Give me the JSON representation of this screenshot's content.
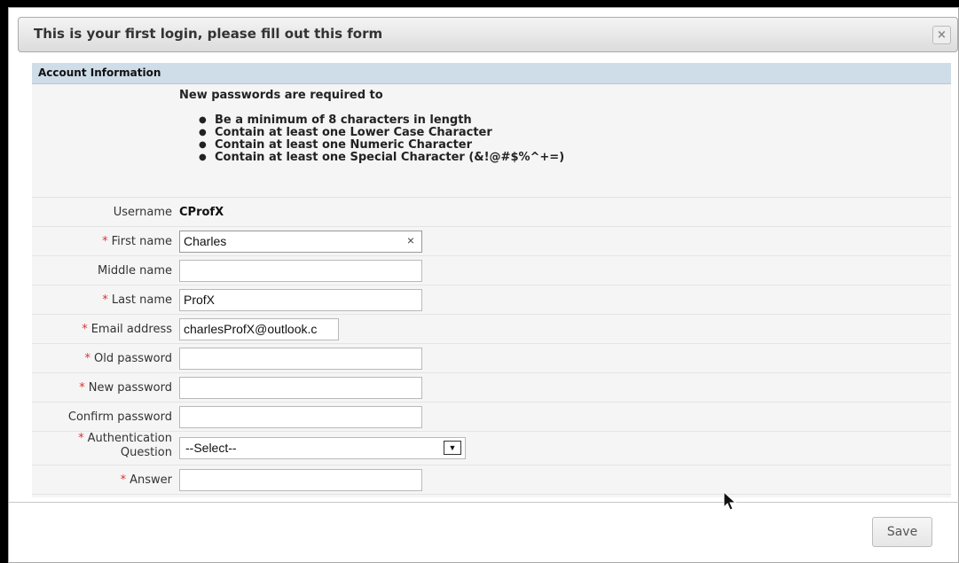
{
  "dialog": {
    "title": "This is your first login, please fill out this form",
    "close_icon": "×"
  },
  "section": {
    "header": "Account Information"
  },
  "requirements": {
    "intro": "New passwords are required to",
    "items": [
      "Be a minimum of 8 characters in length",
      "Contain at least one Lower Case Character",
      "Contain at least one Numeric Character",
      "Contain at least one Special Character (&!@#$%^+=)"
    ]
  },
  "fields": {
    "username": {
      "label": "Username",
      "value": "CProfX"
    },
    "first_name": {
      "label": "First name",
      "required": "*",
      "value": "Charles",
      "clear_icon": "×"
    },
    "middle_name": {
      "label": "Middle name",
      "value": ""
    },
    "last_name": {
      "label": "Last name",
      "required": "*",
      "value": "ProfX"
    },
    "email": {
      "label": "Email address",
      "required": "*",
      "value": "charlesProfX@outlook.c"
    },
    "old_password": {
      "label": "Old password",
      "required": "*",
      "value": ""
    },
    "new_password": {
      "label": "New password",
      "required": "*",
      "value": ""
    },
    "confirm_password": {
      "label": "Confirm password",
      "value": ""
    },
    "auth_question": {
      "label_line1": "Authentication",
      "label_line2": "Question",
      "required": "*",
      "selected": "--Select--"
    },
    "answer": {
      "label": "Answer",
      "required": "*",
      "value": ""
    }
  },
  "footer": {
    "save_label": "Save"
  },
  "colors": {
    "required": "#d9352e",
    "section_header_bg": "#cfdde9",
    "content_bg": "#f5f5f5"
  }
}
